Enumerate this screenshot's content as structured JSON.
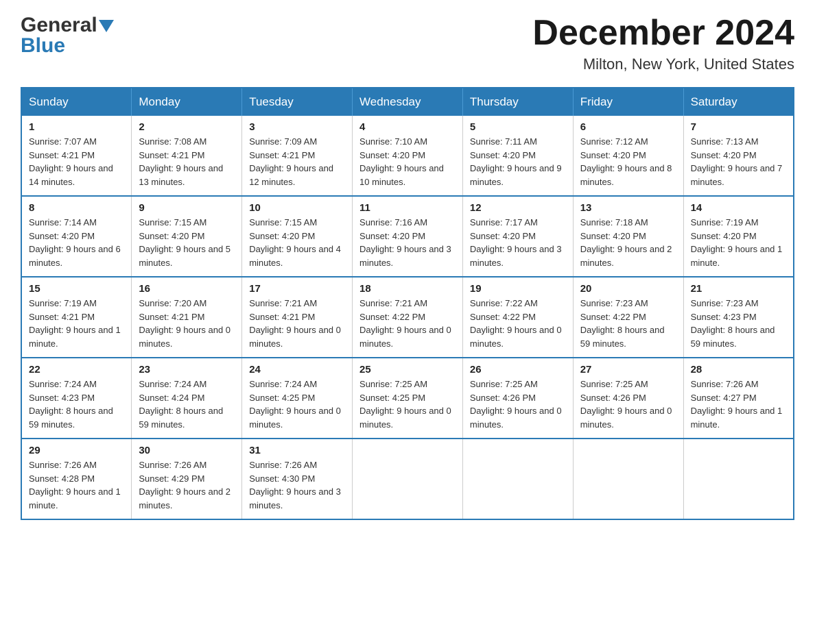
{
  "header": {
    "logo_general": "General",
    "logo_blue": "Blue",
    "month_title": "December 2024",
    "location": "Milton, New York, United States"
  },
  "calendar": {
    "days_of_week": [
      "Sunday",
      "Monday",
      "Tuesday",
      "Wednesday",
      "Thursday",
      "Friday",
      "Saturday"
    ],
    "weeks": [
      [
        {
          "date": "1",
          "sunrise": "7:07 AM",
          "sunset": "4:21 PM",
          "daylight": "9 hours and 14 minutes."
        },
        {
          "date": "2",
          "sunrise": "7:08 AM",
          "sunset": "4:21 PM",
          "daylight": "9 hours and 13 minutes."
        },
        {
          "date": "3",
          "sunrise": "7:09 AM",
          "sunset": "4:21 PM",
          "daylight": "9 hours and 12 minutes."
        },
        {
          "date": "4",
          "sunrise": "7:10 AM",
          "sunset": "4:20 PM",
          "daylight": "9 hours and 10 minutes."
        },
        {
          "date": "5",
          "sunrise": "7:11 AM",
          "sunset": "4:20 PM",
          "daylight": "9 hours and 9 minutes."
        },
        {
          "date": "6",
          "sunrise": "7:12 AM",
          "sunset": "4:20 PM",
          "daylight": "9 hours and 8 minutes."
        },
        {
          "date": "7",
          "sunrise": "7:13 AM",
          "sunset": "4:20 PM",
          "daylight": "9 hours and 7 minutes."
        }
      ],
      [
        {
          "date": "8",
          "sunrise": "7:14 AM",
          "sunset": "4:20 PM",
          "daylight": "9 hours and 6 minutes."
        },
        {
          "date": "9",
          "sunrise": "7:15 AM",
          "sunset": "4:20 PM",
          "daylight": "9 hours and 5 minutes."
        },
        {
          "date": "10",
          "sunrise": "7:15 AM",
          "sunset": "4:20 PM",
          "daylight": "9 hours and 4 minutes."
        },
        {
          "date": "11",
          "sunrise": "7:16 AM",
          "sunset": "4:20 PM",
          "daylight": "9 hours and 3 minutes."
        },
        {
          "date": "12",
          "sunrise": "7:17 AM",
          "sunset": "4:20 PM",
          "daylight": "9 hours and 3 minutes."
        },
        {
          "date": "13",
          "sunrise": "7:18 AM",
          "sunset": "4:20 PM",
          "daylight": "9 hours and 2 minutes."
        },
        {
          "date": "14",
          "sunrise": "7:19 AM",
          "sunset": "4:20 PM",
          "daylight": "9 hours and 1 minute."
        }
      ],
      [
        {
          "date": "15",
          "sunrise": "7:19 AM",
          "sunset": "4:21 PM",
          "daylight": "9 hours and 1 minute."
        },
        {
          "date": "16",
          "sunrise": "7:20 AM",
          "sunset": "4:21 PM",
          "daylight": "9 hours and 0 minutes."
        },
        {
          "date": "17",
          "sunrise": "7:21 AM",
          "sunset": "4:21 PM",
          "daylight": "9 hours and 0 minutes."
        },
        {
          "date": "18",
          "sunrise": "7:21 AM",
          "sunset": "4:22 PM",
          "daylight": "9 hours and 0 minutes."
        },
        {
          "date": "19",
          "sunrise": "7:22 AM",
          "sunset": "4:22 PM",
          "daylight": "9 hours and 0 minutes."
        },
        {
          "date": "20",
          "sunrise": "7:23 AM",
          "sunset": "4:22 PM",
          "daylight": "8 hours and 59 minutes."
        },
        {
          "date": "21",
          "sunrise": "7:23 AM",
          "sunset": "4:23 PM",
          "daylight": "8 hours and 59 minutes."
        }
      ],
      [
        {
          "date": "22",
          "sunrise": "7:24 AM",
          "sunset": "4:23 PM",
          "daylight": "8 hours and 59 minutes."
        },
        {
          "date": "23",
          "sunrise": "7:24 AM",
          "sunset": "4:24 PM",
          "daylight": "8 hours and 59 minutes."
        },
        {
          "date": "24",
          "sunrise": "7:24 AM",
          "sunset": "4:25 PM",
          "daylight": "9 hours and 0 minutes."
        },
        {
          "date": "25",
          "sunrise": "7:25 AM",
          "sunset": "4:25 PM",
          "daylight": "9 hours and 0 minutes."
        },
        {
          "date": "26",
          "sunrise": "7:25 AM",
          "sunset": "4:26 PM",
          "daylight": "9 hours and 0 minutes."
        },
        {
          "date": "27",
          "sunrise": "7:25 AM",
          "sunset": "4:26 PM",
          "daylight": "9 hours and 0 minutes."
        },
        {
          "date": "28",
          "sunrise": "7:26 AM",
          "sunset": "4:27 PM",
          "daylight": "9 hours and 1 minute."
        }
      ],
      [
        {
          "date": "29",
          "sunrise": "7:26 AM",
          "sunset": "4:28 PM",
          "daylight": "9 hours and 1 minute."
        },
        {
          "date": "30",
          "sunrise": "7:26 AM",
          "sunset": "4:29 PM",
          "daylight": "9 hours and 2 minutes."
        },
        {
          "date": "31",
          "sunrise": "7:26 AM",
          "sunset": "4:30 PM",
          "daylight": "9 hours and 3 minutes."
        },
        null,
        null,
        null,
        null
      ]
    ]
  }
}
